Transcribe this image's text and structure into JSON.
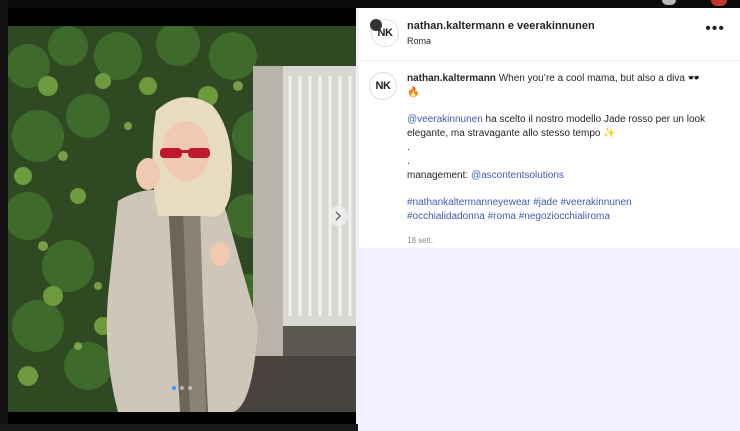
{
  "post": {
    "header": {
      "avatar_initials": "NK",
      "accounts_line": "nathan.kaltermann e veerakinnunen",
      "location": "Roma",
      "more_icon": "ellipsis-icon"
    },
    "caption": {
      "avatar_initials": "NK",
      "author": "nathan.kaltermann",
      "intro": "When you’re a cool mama, but also a diva 🕶️",
      "intro_emoji": "🔥",
      "mention": "@veerakinnunen",
      "body": "ha scelto il nostro modello Jade rosso per un look elegante, ma stravagante allo stesso tempo",
      "body_emoji": "✨",
      "dot1": ".",
      "dot2": ".",
      "management_label": "management:",
      "management_mention": "@ascontentsolutions",
      "hashtags_line1": "#nathankaltermanneyewear #jade #veerakinnunen",
      "hashtags_line2": "#occhialidadonna #roma #negoziocchialiroma",
      "timestamp": "18 sett."
    },
    "media": {
      "next_icon": "chevron-right-icon",
      "carousel_dots": 3,
      "active_dot": 0
    }
  }
}
